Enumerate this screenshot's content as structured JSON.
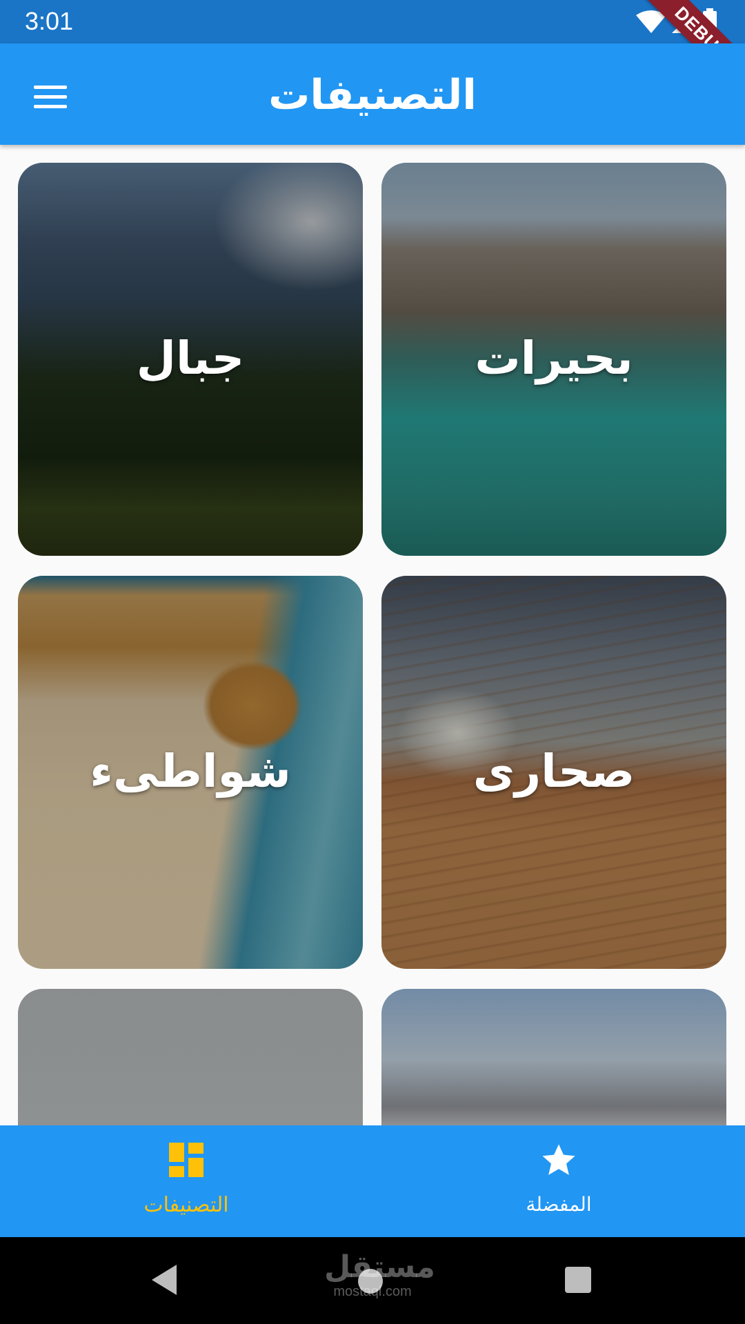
{
  "status_bar": {
    "time": "3:01",
    "icons": [
      "wifi-icon",
      "signal-icon",
      "battery-icon"
    ],
    "debug_banner": "DEBUG"
  },
  "app_bar": {
    "title": "التصنيفات",
    "menu_icon": "menu-icon"
  },
  "categories": [
    {
      "label": "بحيرات",
      "image": "lake-image"
    },
    {
      "label": "جبال",
      "image": "mountains-image"
    },
    {
      "label": "صحارى",
      "image": "desert-image"
    },
    {
      "label": "شواطىء",
      "image": "beach-image"
    },
    {
      "label": "",
      "image": "snow-mountains-image"
    },
    {
      "label": "",
      "image": "town-image"
    }
  ],
  "bottom_nav": {
    "items": [
      {
        "label": "التصنيفات",
        "icon": "dashboard-icon",
        "active": true
      },
      {
        "label": "المفضلة",
        "icon": "star-icon",
        "active": false
      }
    ],
    "active_color": "#ffc107",
    "background": "#2196f3"
  },
  "system_nav": {
    "watermark_ar": "مستقل",
    "watermark_en": "mostaql.com"
  },
  "colors": {
    "primary": "#2196f3",
    "status_bar": "#1b75c7",
    "accent": "#ffc107"
  }
}
